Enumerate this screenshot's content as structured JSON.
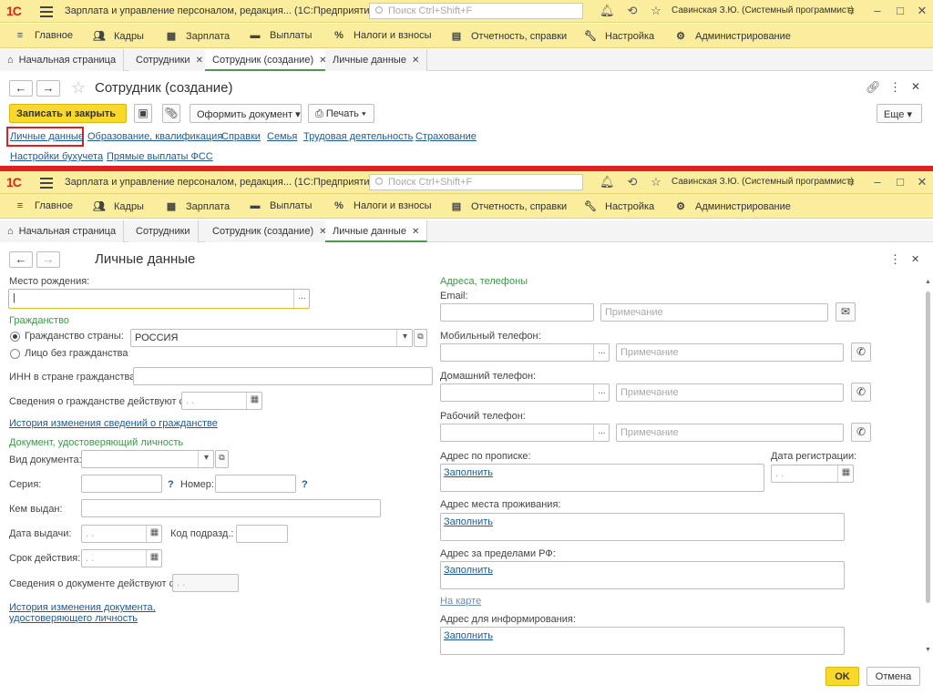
{
  "app": {
    "logo": "1С",
    "window_title": "Зарплата и управление персоналом, редакция...  (1С:Предприятие)",
    "search_placeholder": "Поиск Ctrl+Shift+F",
    "user": "Савинская З.Ю. (Системный программист)"
  },
  "menu": [
    "Главное",
    "Кадры",
    "Зарплата",
    "Выплаты",
    "Налоги и взносы",
    "Отчетность, справки",
    "Настройка",
    "Администрирование"
  ],
  "tabs": [
    "Начальная страница",
    "Сотрудники",
    "Сотрудник (создание)",
    "Личные данные"
  ],
  "top_form": {
    "title": "Сотрудник (создание)",
    "save_close": "Записать и закрыть",
    "create_doc": "Оформить документ",
    "print": "Печать",
    "more": "Еще",
    "links": [
      "Личные данные",
      "Образование, квалификация",
      "Справки",
      "Семья",
      "Трудовая деятельность",
      "Страхование",
      "Настройки бухучета",
      "Прямые выплаты ФСС"
    ]
  },
  "personal": {
    "title": "Личные данные",
    "birthplace_label": "Место рождения:",
    "citizenship_group": "Гражданство",
    "citizenship_country_label": "Гражданство страны:",
    "citizenship_country_value": "РОССИЯ",
    "stateless_label": "Лицо без гражданства",
    "inn_label": "ИНН в стране гражданства:",
    "citizenship_valid_label": "Сведения о гражданстве действуют с:",
    "date_placeholder": " .  .",
    "citizenship_history_link": "История изменения сведений о гражданстве",
    "id_doc_group": "Документ, удостоверяющий личность",
    "doc_type_label": "Вид документа:",
    "series_label": "Серия:",
    "number_label": "Номер:",
    "help": "?",
    "issued_by_label": "Кем выдан:",
    "issue_date_label": "Дата выдачи:",
    "dept_code_label": "Код подразд.:",
    "validity_label": "Срок действия:",
    "doc_valid_label": "Сведения о документе действуют с:",
    "doc_history_link_1": "История изменения документа,",
    "doc_history_link_2": "удостоверяющего личность",
    "contacts_group": "Адреса, телефоны",
    "email_label": "Email:",
    "note_placeholder": "Примечание",
    "mobile_label": "Мобильный телефон:",
    "home_label": "Домашний телефон:",
    "work_label": "Рабочий телефон:",
    "reg_address_label": "Адрес по прописке:",
    "reg_date_label": "Дата регистрации:",
    "fill_link": "Заполнить",
    "live_address_label": "Адрес места проживания:",
    "foreign_address_label": "Адрес за пределами РФ:",
    "map_link": "На карте",
    "info_address_label": "Адрес для информирования:",
    "ok": "OK",
    "cancel": "Отмена"
  },
  "colors": {
    "accent_yellow": "#f8d82b",
    "titlebar": "#fbed9e",
    "link": "#1c5b9a",
    "group": "#3a9a47",
    "highlight": "#e02020"
  }
}
